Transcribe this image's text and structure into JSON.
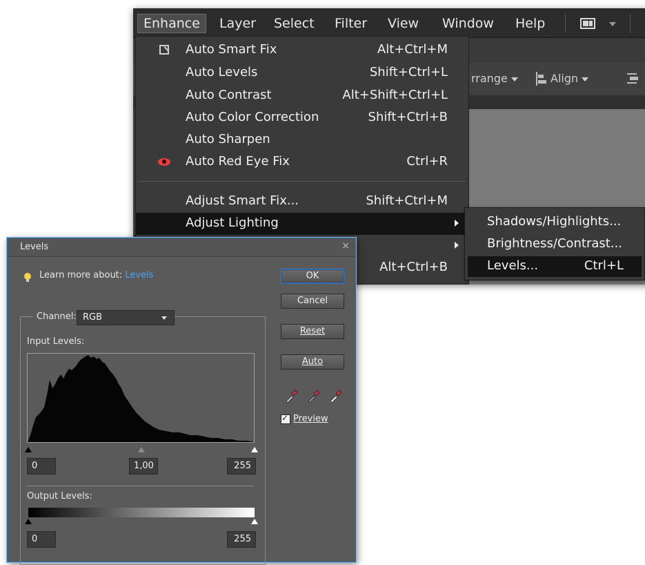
{
  "menubar": {
    "items": [
      "Enhance",
      "Layer",
      "Select",
      "Filter",
      "View",
      "Window",
      "Help"
    ]
  },
  "toolbar": {
    "arrange_label": "rrange",
    "align_label": "Align"
  },
  "enhance_menu": {
    "items": [
      {
        "label": "Auto Smart Fix",
        "shortcut": "Alt+Ctrl+M",
        "icon": "smart-fix-icon"
      },
      {
        "label": "Auto Levels",
        "shortcut": "Shift+Ctrl+L"
      },
      {
        "label": "Auto Contrast",
        "shortcut": "Alt+Shift+Ctrl+L"
      },
      {
        "label": "Auto Color Correction",
        "shortcut": "Shift+Ctrl+B"
      },
      {
        "label": "Auto Sharpen",
        "shortcut": ""
      },
      {
        "label": "Auto Red Eye Fix",
        "shortcut": "Ctrl+R",
        "icon": "red-eye-icon"
      },
      {
        "label": "Adjust Smart Fix...",
        "shortcut": "Shift+Ctrl+M"
      },
      {
        "label": "Adjust Lighting",
        "shortcut": "",
        "highlighted": true,
        "has_submenu": true
      },
      {
        "label": "",
        "shortcut": "",
        "has_submenu": true
      },
      {
        "label": "...",
        "shortcut": "Alt+Ctrl+B"
      }
    ]
  },
  "lighting_submenu": {
    "items": [
      {
        "label": "Shadows/Highlights...",
        "shortcut": ""
      },
      {
        "label": "Brightness/Contrast...",
        "shortcut": ""
      },
      {
        "label": "Levels...",
        "shortcut": "Ctrl+L",
        "highlighted": true
      }
    ]
  },
  "levels_dialog": {
    "title": "Levels",
    "close": "×",
    "learn_more_prefix": "Learn more about: ",
    "learn_more_link": "Levels",
    "buttons": {
      "ok": "OK",
      "cancel": "Cancel",
      "reset": "Reset",
      "auto": "Auto"
    },
    "channel_label": "Channel:",
    "channel_value": "RGB",
    "input_levels_label": "Input Levels:",
    "input_black": "0",
    "input_gamma": "1,00",
    "input_white": "255",
    "output_levels_label": "Output Levels:",
    "output_black": "0",
    "output_white": "255",
    "preview_label": "Preview",
    "preview_checked": true
  },
  "colors": {
    "app_bg": "#3a3a3a",
    "menu_highlight": "#141414",
    "dialog_bg": "#5a5a5a",
    "link_blue": "#4aa3ff",
    "dialog_border": "#2a6ab0"
  }
}
